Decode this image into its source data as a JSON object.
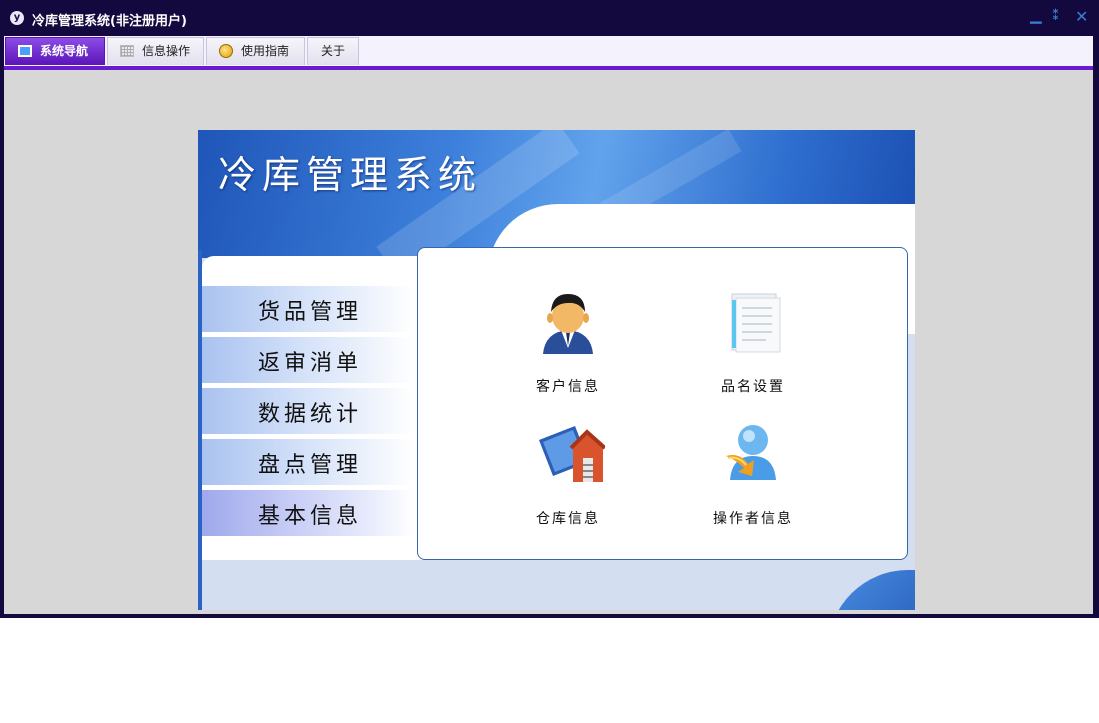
{
  "window": {
    "title": "冷库管理系统(非注册用户)",
    "app_icon_glyph": "y",
    "controls": {
      "minimize": "▁",
      "maximize": "⁑",
      "close": "✕"
    }
  },
  "tabs": [
    {
      "label": "系统导航",
      "icon": "monitor-icon",
      "active": true
    },
    {
      "label": "信息操作",
      "icon": "grid-icon",
      "active": false
    },
    {
      "label": "使用指南",
      "icon": "guide-icon",
      "active": false
    },
    {
      "label": "关于",
      "icon": null,
      "active": false
    }
  ],
  "panel": {
    "title": "冷库管理系统"
  },
  "nav": [
    {
      "label": "货品管理",
      "selected": false
    },
    {
      "label": "返审消单",
      "selected": false
    },
    {
      "label": "数据统计",
      "selected": false
    },
    {
      "label": "盘点管理",
      "selected": false
    },
    {
      "label": "基本信息",
      "selected": true
    }
  ],
  "tiles": [
    {
      "label": "客户信息",
      "icon": "customer-icon"
    },
    {
      "label": "品名设置",
      "icon": "document-icon"
    },
    {
      "label": "仓库信息",
      "icon": "warehouse-icon"
    },
    {
      "label": "操作者信息",
      "icon": "operator-icon"
    }
  ],
  "colors": {
    "titlebar_bg": "#14093e",
    "tab_accent": "#6a1bd0",
    "content_bg": "#d7d7d7",
    "panel_blue": "#2f6fcf",
    "icon_box_border": "#3766b0"
  }
}
